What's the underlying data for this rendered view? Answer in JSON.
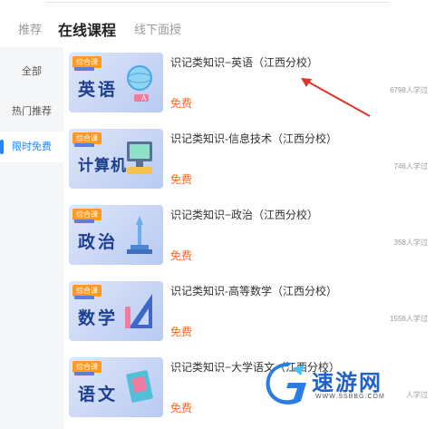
{
  "tabs": [
    {
      "label": "推荐"
    },
    {
      "label": "在线课程"
    },
    {
      "label": "线下面授"
    }
  ],
  "sidebar": {
    "items": [
      {
        "label": "全部"
      },
      {
        "label": "热门推荐"
      },
      {
        "label": "限时免费"
      }
    ],
    "active_index": 2
  },
  "courses": [
    {
      "badge": "综合课",
      "thumb_text": "英语",
      "title": "识记类知识−英语（江西分校）",
      "price": "免费",
      "learners": "6798人学过",
      "deco_icon": "globe-icon"
    },
    {
      "badge": "综合课",
      "thumb_text": "计算机",
      "title": "识记类知识-信息技术（江西分校）",
      "price": "免费",
      "learners": "746人学过",
      "deco_icon": "computer-icon"
    },
    {
      "badge": "综合课",
      "thumb_text": "政治",
      "title": "识记类知识−政治（江西分校）",
      "price": "免费",
      "learners": "358人学过",
      "deco_icon": "monument-icon"
    },
    {
      "badge": "综合课",
      "thumb_text": "数学",
      "title": "识记类知识-高等数学（江西分校）",
      "price": "免费",
      "learners": "1556人学过",
      "deco_icon": "triangle-ruler-icon"
    },
    {
      "badge": "综合课",
      "thumb_text": "语文",
      "title": "识记类知识−大学语文（江西分校）",
      "price": "免费",
      "learners": "人学过",
      "deco_icon": "book-icon"
    }
  ],
  "watermark": {
    "text": "速游网",
    "url": "WWW.SSBBG.COM"
  },
  "colors": {
    "accent": "#1e86ff",
    "price": "#ff6a1a",
    "badge": "#ff9a1f",
    "arrow": "#e0342a"
  }
}
